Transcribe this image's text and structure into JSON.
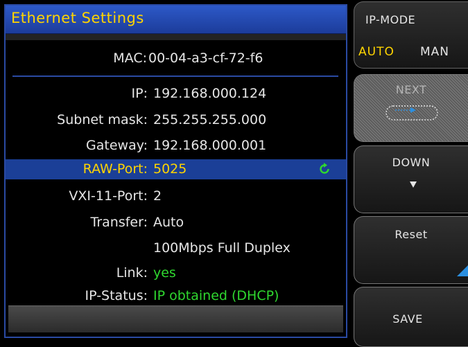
{
  "dialog": {
    "title": "Ethernet Settings",
    "mac": {
      "label": "MAC:",
      "value": "00-04-a3-cf-72-f6"
    },
    "fields": {
      "ip": {
        "label": "IP:",
        "value": "192.168.000.124"
      },
      "subnet": {
        "label": "Subnet mask:",
        "value": "255.255.255.000"
      },
      "gateway": {
        "label": "Gateway:",
        "value": "192.168.000.001"
      },
      "raw_port": {
        "label": "RAW-Port:",
        "value": "5025"
      },
      "vxi_port": {
        "label": "VXI-11-Port:",
        "value": "2"
      },
      "transfer": {
        "label": "Transfer:",
        "value": "Auto"
      },
      "transfer_detail": {
        "value": "100Mbps Full Duplex"
      },
      "link": {
        "label": "Link:",
        "value": "yes"
      },
      "ip_status": {
        "label": "IP-Status:",
        "value": "IP obtained (DHCP)"
      }
    }
  },
  "softkeys": {
    "ip_mode": {
      "label": "IP-MODE",
      "opt_auto": "AUTO",
      "opt_man": "MAN"
    },
    "next": {
      "label": "NEXT"
    },
    "down": {
      "label": "DOWN"
    },
    "reset": {
      "label": "Reset"
    },
    "save": {
      "label": "SAVE"
    }
  },
  "colors": {
    "title": "#ffd400",
    "selection": "#1b3f97",
    "status_green": "#2fd82f",
    "accent_blue": "#2b8fe0"
  }
}
